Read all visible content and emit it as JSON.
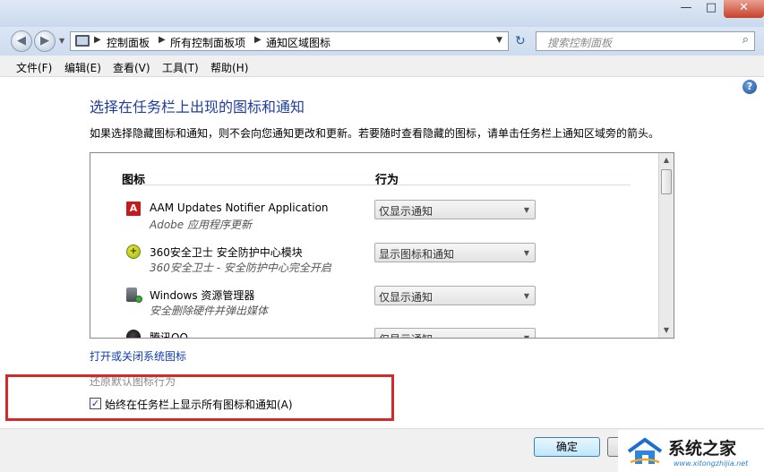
{
  "window": {
    "min_glyph": "—",
    "max_glyph": "□",
    "close_glyph": "✕"
  },
  "address": {
    "crumbs": [
      "控制面板",
      "所有控制面板项",
      "通知区域图标"
    ],
    "search_placeholder": "搜索控制面板"
  },
  "menu": {
    "items": [
      "文件(F)",
      "编辑(E)",
      "查看(V)",
      "工具(T)",
      "帮助(H)"
    ]
  },
  "content": {
    "title": "选择在任务栏上出现的图标和通知",
    "description": "如果选择隐藏图标和通知，则不会向您通知更改和更新。若要随时查看隐藏的图标，请单击任务栏上通知区域旁的箭头。",
    "columns": {
      "icon": "图标",
      "action": "行为"
    },
    "rows": [
      {
        "icon": "adobe-icon",
        "name": "AAM Updates Notifier Application",
        "sub": "Adobe 应用程序更新",
        "action": "仅显示通知"
      },
      {
        "icon": "360-icon",
        "name": "360安全卫士 安全防护中心模块",
        "sub": "360安全卫士 - 安全防护中心完全开启",
        "action": "显示图标和通知"
      },
      {
        "icon": "usb-icon",
        "name": "Windows 资源管理器",
        "sub": "安全删除硬件并弹出媒体",
        "action": "仅显示通知"
      },
      {
        "icon": "qq-icon",
        "name": "腾讯QQ",
        "sub": "",
        "action": "仅显示通知"
      }
    ],
    "link_toggle_system_icons": "打开或关闭系统图标",
    "link_restore_default": "还原默认图标行为",
    "always_show_checkbox": {
      "label": "始终在任务栏上显示所有图标和通知(A)",
      "checked": true
    }
  },
  "footer": {
    "ok_label": "确定"
  },
  "watermark": {
    "text": "系统之家",
    "url": "www.xitongzhijia.net"
  },
  "colors": {
    "title_blue": "#1f3d9b",
    "link_blue": "#0c3eb0",
    "highlight_red": "#d32b2b"
  }
}
